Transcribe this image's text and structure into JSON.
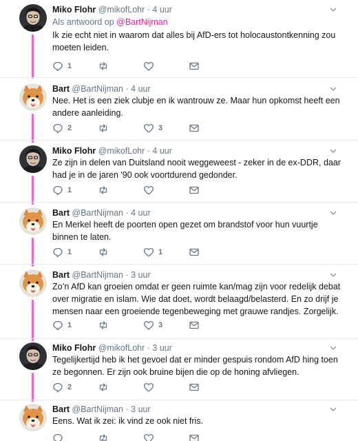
{
  "tweets": [
    {
      "name": "Miko Flohr",
      "handle": "@mikofLohr",
      "time": "4 uur",
      "reply_prefix": "Als antwoord op",
      "reply_mention": "@BartNijman",
      "text": "Ik zie echt niet in waarom dat alles bij AfD-ers tot holocaustontkenning zou moeten leiden.",
      "reply_count": "1",
      "retweet_count": "",
      "like_count": "",
      "avatar": "man-avatar"
    },
    {
      "name": "Bart",
      "handle": "@BartNijman",
      "time": "4 uur",
      "text": "Nee. Het is een ziek clubje en ik wantrouw ze. Maar hun opkomst heeft een andere aanleiding.",
      "reply_count": "2",
      "retweet_count": "",
      "like_count": "3",
      "avatar": "shiba-avatar"
    },
    {
      "name": "Miko Flohr",
      "handle": "@mikofLohr",
      "time": "4 uur",
      "text": "Ze zijn in delen van Duitsland nooit weggeweest - zeker in de ex-DDR, daar had je in de jaren '90 ook voortdurend gedonder.",
      "reply_count": "1",
      "retweet_count": "",
      "like_count": "",
      "avatar": "man-avatar"
    },
    {
      "name": "Bart",
      "handle": "@BartNijman",
      "time": "4 uur",
      "text": "En Merkel heeft de poorten open gezet om brandstof voor hun vuurtje binnen te laten.",
      "reply_count": "1",
      "retweet_count": "",
      "like_count": "1",
      "avatar": "shiba-avatar"
    },
    {
      "name": "Bart",
      "handle": "@BartNijman",
      "time": "3 uur",
      "text": "Zo’n AfD kan groeien omdat er geen ruimte kan/mag zijn voor redelijk debat over migratie en islam. Wie dat doet, wordt belaagd/belasterd. En zo drijf je mensen naar een groeiende tegenbeweging met grauwe randjes. Zorgelijk.",
      "reply_count": "1",
      "retweet_count": "",
      "like_count": "3",
      "avatar": "shiba-avatar"
    },
    {
      "name": "Miko Flohr",
      "handle": "@mikofLohr",
      "time": "3 uur",
      "text": "Tegelijkertijd heb ik het gevoel dat er minder gespuis rondom AfD hing toen ze begonnen. Er zijn ook bruine bijen die op de honing afvliegen.",
      "reply_count": "2",
      "retweet_count": "",
      "like_count": "",
      "avatar": "man-avatar"
    },
    {
      "name": "Bart",
      "handle": "@BartNijman",
      "time": "3 uur",
      "text": "Eens. Wat ik zei: ik vind ze ook niet fris.",
      "reply_count": "",
      "retweet_count": "",
      "like_count": "",
      "avatar": "shiba-avatar"
    }
  ],
  "dot": "·",
  "colors": {
    "thread_line": "#e86bc8",
    "mention": "#e0249c",
    "muted": "#657786"
  }
}
